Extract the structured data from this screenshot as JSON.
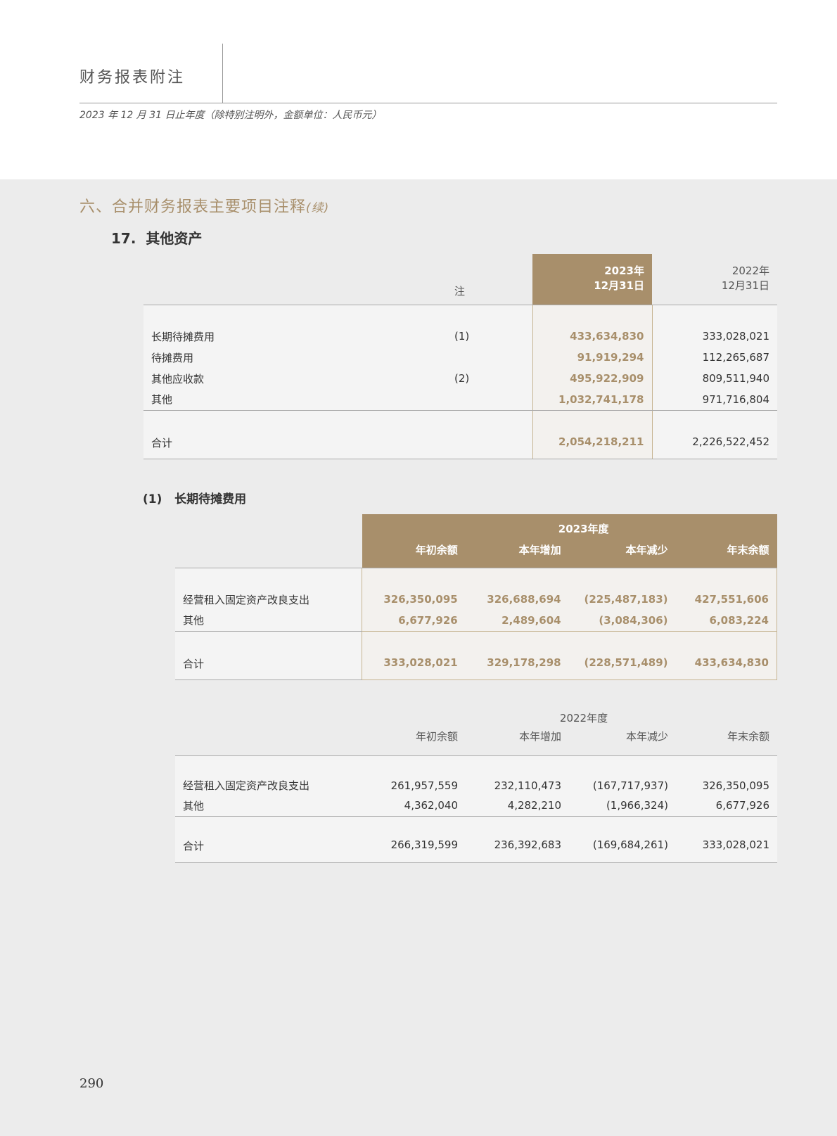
{
  "header": {
    "title": "财务报表附注",
    "subtitle": "2023 年 12 月 31 日止年度（除特别注明外，金额单位：人民币元）"
  },
  "section": {
    "title": "六、合并财务报表主要项目注释",
    "continued": "(续)"
  },
  "item": {
    "number": "17.",
    "title": "其他资产"
  },
  "other_assets": {
    "headers": {
      "note": "注",
      "cur_year": "2023年",
      "cur_date": "12月31日",
      "prev_year": "2022年",
      "prev_date": "12月31日"
    },
    "rows": [
      {
        "label": "长期待摊费用",
        "note": "(1)",
        "cur": "433,634,830",
        "prev": "333,028,021"
      },
      {
        "label": "待摊费用",
        "note": "",
        "cur": "91,919,294",
        "prev": "112,265,687"
      },
      {
        "label": "其他应收款",
        "note": "(2)",
        "cur": "495,922,909",
        "prev": "809,511,940"
      },
      {
        "label": "其他",
        "note": "",
        "cur": "1,032,741,178",
        "prev": "971,716,804"
      }
    ],
    "total": {
      "label": "合计",
      "cur": "2,054,218,211",
      "prev": "2,226,522,452"
    }
  },
  "sub1": {
    "number": "(1)",
    "title": "长期待摊费用"
  },
  "ltpe_2023": {
    "period": "2023年度",
    "columns": [
      "年初余额",
      "本年增加",
      "本年减少",
      "年末余额"
    ],
    "rows": [
      {
        "label": "经营租入固定资产改良支出",
        "values": [
          "326,350,095",
          "326,688,694",
          "(225,487,183)",
          "427,551,606"
        ]
      },
      {
        "label": "其他",
        "values": [
          "6,677,926",
          "2,489,604",
          "(3,084,306)",
          "6,083,224"
        ]
      }
    ],
    "total": {
      "label": "合计",
      "values": [
        "333,028,021",
        "329,178,298",
        "(228,571,489)",
        "433,634,830"
      ]
    }
  },
  "ltpe_2022": {
    "period": "2022年度",
    "columns": [
      "年初余额",
      "本年增加",
      "本年减少",
      "年末余额"
    ],
    "rows": [
      {
        "label": "经营租入固定资产改良支出",
        "values": [
          "261,957,559",
          "232,110,473",
          "(167,717,937)",
          "326,350,095"
        ]
      },
      {
        "label": "其他",
        "values": [
          "4,362,040",
          "4,282,210",
          "(1,966,324)",
          "6,677,926"
        ]
      }
    ],
    "total": {
      "label": "合计",
      "values": [
        "266,319,599",
        "236,392,683",
        "(169,684,261)",
        "333,028,021"
      ]
    }
  },
  "footer": {
    "page_number": "290"
  }
}
